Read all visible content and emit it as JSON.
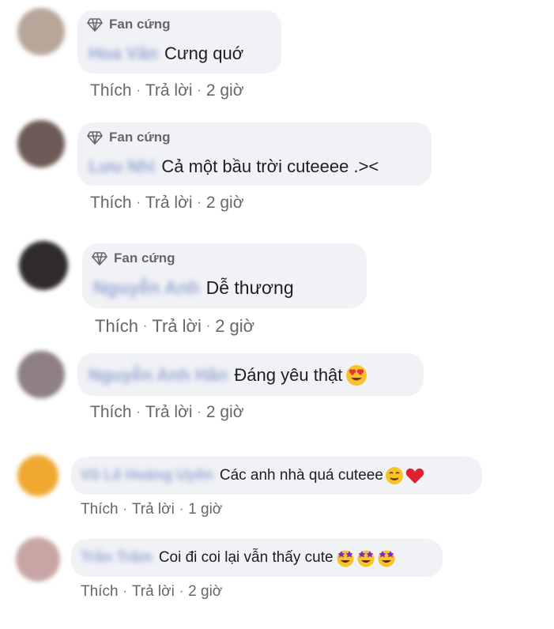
{
  "badge_label": "Fan cứng",
  "actions": {
    "like": "Thích",
    "reply": "Trả lời",
    "sep": "·"
  },
  "comments": [
    {
      "name": "Hoa Vân",
      "text": "Cưng quớ",
      "time": "2 giờ",
      "avatar_color": "#b9a69a"
    },
    {
      "name": "Lưu Nhi",
      "text": "Cả một bầu trời cuteeee .><",
      "time": "2 giờ",
      "avatar_color": "#6e5a55"
    },
    {
      "name": "Nguyễn Anh",
      "text": "Dễ thương",
      "time": "2 giờ",
      "avatar_color": "#2f2a2b"
    },
    {
      "name": "Nguyễn Anh Hân",
      "text": "Đáng yêu thật",
      "time": "2 giờ",
      "avatar_color": "#8d7f82"
    },
    {
      "name": "Vũ Lê Hoàng Uyên",
      "text": "Các anh nhà quá cuteee",
      "time": "1 giờ",
      "avatar_color": "#f0a830"
    },
    {
      "name": "Trần Trâm",
      "text": "Coi đi coi lại vẫn thấy cute",
      "time": "2 giờ",
      "avatar_color": "#c8a5a3"
    }
  ]
}
